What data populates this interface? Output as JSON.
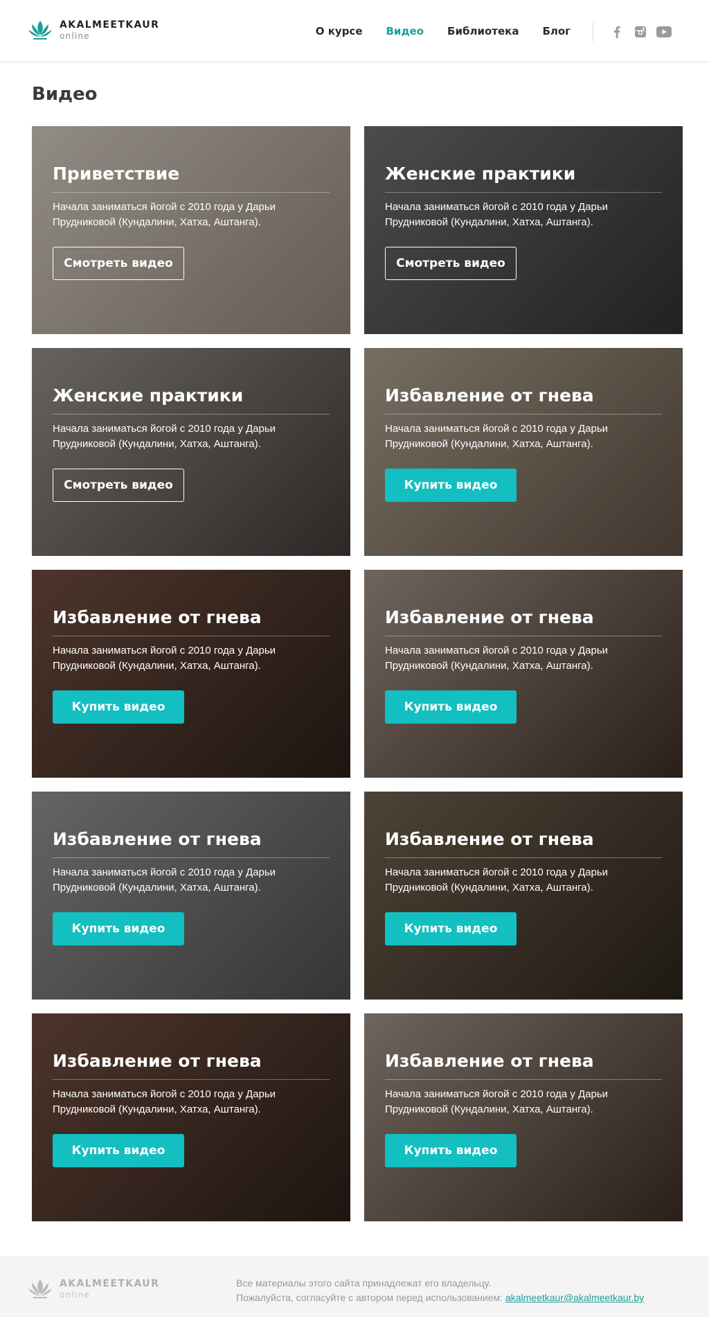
{
  "header": {
    "logo_name": "AKALMEETKAUR",
    "logo_sub": "online",
    "nav": [
      {
        "label": "О курсе",
        "active": false
      },
      {
        "label": "Видео",
        "active": true
      },
      {
        "label": "Библиотека",
        "active": false
      },
      {
        "label": "Блог",
        "active": false
      }
    ],
    "socials": [
      "facebook-icon",
      "instagram-icon",
      "youtube-icon"
    ]
  },
  "page": {
    "title": "Видео"
  },
  "cards": [
    {
      "title": "Приветствие",
      "desc": "Начала заниматься йогой с 2010 года у Дарьи Прудниковой (Кундалини, Хатха, Аштанга).",
      "button": "Смотреть видео",
      "style": "outline",
      "bg": [
        "#c9c2b8",
        "#8c7f73"
      ]
    },
    {
      "title": "Женские практики",
      "desc": "Начала заниматься йогой с 2010 года у Дарьи Прудниковой (Кундалини, Хатха, Аштанга).",
      "button": "Смотреть видео",
      "style": "outline",
      "bg": [
        "#6a6a6a",
        "#2f2f2f"
      ]
    },
    {
      "title": "Женские практики",
      "desc": "Начала заниматься йогой с 2010 года у Дарьи Прудниковой (Кундалини, Хатха, Аштанга).",
      "button": "Смотреть видео",
      "style": "outline",
      "bg": [
        "#8e8a85",
        "#3d3836"
      ]
    },
    {
      "title": "Избавление от гнева",
      "desc": "Начала заниматься йогой с 2010 года у Дарьи Прудниковой (Кундалини, Хатха, Аштанга).",
      "button": "Купить видео",
      "style": "fill",
      "bg": [
        "#a59a8a",
        "#5a4c40"
      ]
    },
    {
      "title": "Избавление от гнева",
      "desc": "Начала заниматься йогой с 2010 года у Дарьи Прудниковой (Кундалини, Хатха, Аштанга).",
      "button": "Купить видео",
      "style": "fill",
      "bg": [
        "#6b4a3c",
        "#2a1e18"
      ]
    },
    {
      "title": "Избавление от гнева",
      "desc": "Начала заниматься йогой с 2010 года у Дарьи Прудниковой (Кундалини, Хатха, Аштанга).",
      "button": "Купить видео",
      "style": "fill",
      "bg": [
        "#9a8c80",
        "#3b2c24"
      ]
    },
    {
      "title": "Избавление от гнева",
      "desc": "Начала заниматься йогой с 2010 года у Дарьи Прудниковой (Кундалини, Хатха, Аштанга).",
      "button": "Купить видео",
      "style": "fill",
      "bg": [
        "#8c8c8c",
        "#4a4a4a"
      ]
    },
    {
      "title": "Избавление от гнева",
      "desc": "Начала заниматься йогой с 2010 года у Дарьи Прудниковой (Кундалини, Хатха, Аштанга).",
      "button": "Купить видео",
      "style": "fill",
      "bg": [
        "#6d5d4c",
        "#2b241c"
      ]
    },
    {
      "title": "Избавление от гнева",
      "desc": "Начала заниматься йогой с 2010 года у Дарьи Прудниковой (Кундалини, Хатха, Аштанга).",
      "button": "Купить видео",
      "style": "fill",
      "bg": [
        "#6b4a3c",
        "#2a1e18"
      ]
    },
    {
      "title": "Избавление от гнева",
      "desc": "Начала заниматься йогой с 2010 года у Дарьи Прудниковой (Кундалини, Хатха, Аштанга).",
      "button": "Купить видео",
      "style": "fill",
      "bg": [
        "#9a8c80",
        "#3b2c24"
      ]
    }
  ],
  "footer": {
    "logo_name": "AKALMEETKAUR",
    "logo_sub": "online",
    "line1": "Все материалы этого сайта принадлежат его владельцу.",
    "line2": "Пожалуйста, согласуйте с автором перед использованием: ",
    "email": "akalmeetkaur@akalmeetkaur.by"
  },
  "colors": {
    "accent": "#13bfc0",
    "nav_active": "#1a9e9a"
  }
}
